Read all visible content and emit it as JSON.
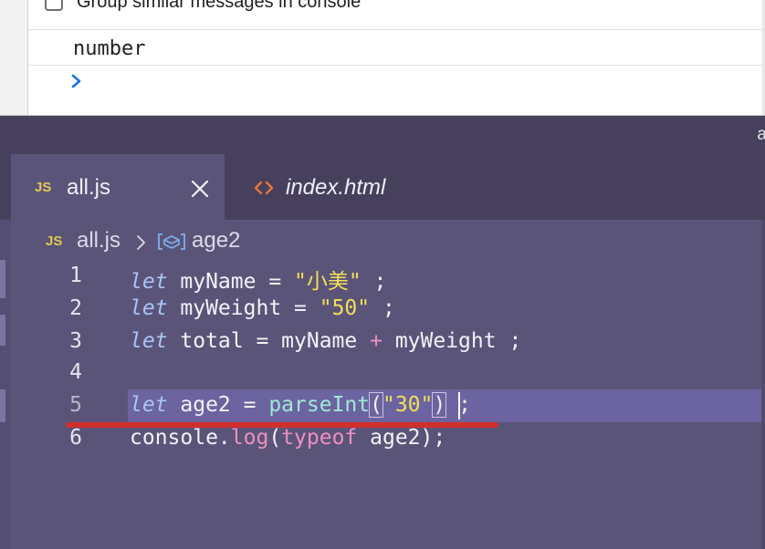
{
  "console": {
    "group_similar_label": "Group similar messages in console",
    "group_similar_checked": false,
    "output": "number"
  },
  "editor": {
    "title_fragment": "a",
    "tabs": [
      {
        "icon": "JS",
        "label": "all.js",
        "active": true
      },
      {
        "icon": "html-icon",
        "label": "index.html",
        "active": false
      }
    ],
    "breadcrumb": {
      "file_icon": "JS",
      "file": "all.js",
      "symbol": "age2"
    },
    "line_numbers": [
      "1",
      "2",
      "3",
      "4",
      "5",
      "6"
    ],
    "code": {
      "l1": {
        "kw": "let",
        "text": " myName = ",
        "str": "\"小美\"",
        "end": " ;"
      },
      "l2": {
        "kw": "let",
        "text": " myWeight = ",
        "str": "\"50\"",
        "end": " ;"
      },
      "l3": {
        "kw": "let",
        "text": " total = myName ",
        "op": "+",
        "end": " myWeight ;"
      },
      "l5": {
        "kw": "let",
        "text": " age2 = ",
        "fn": "parseInt",
        "open": "(",
        "str": "\"30\"",
        "close": ")",
        "end": " ;"
      },
      "l6": {
        "obj": "console.",
        "fn": "log",
        "open": "(",
        "kw": "typeof",
        "end": " age2);"
      }
    },
    "active_line": 5
  },
  "colors": {
    "editor_bg": "#5b5479",
    "tabbar_bg": "#47405d",
    "keyword": "#a9c4f4",
    "string": "#f2df5a",
    "function": "#9fe8d6",
    "error_underline": "#d12e2c"
  }
}
